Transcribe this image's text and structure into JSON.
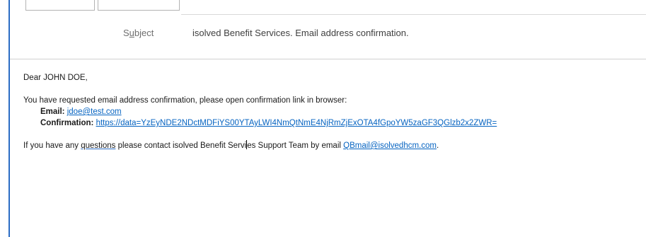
{
  "header": {
    "subject_label_pre": "S",
    "subject_label_ul": "u",
    "subject_label_post": "bject",
    "subject_value": "isolved Benefit Services. Email address confirmation."
  },
  "message": {
    "greeting": "Dear JOHN DOE,",
    "intro": "You have requested email address confirmation, please open confirmation link in browser:",
    "email_label": "Email:",
    "email_value": "jdoe@test.com",
    "confirmation_label": "Confirmation:",
    "confirmation_link": "https://data=YzEyNDE2NDctMDFiYS00YTAyLWI4NmQtNmE4NjRmZjExOTA4fGpoYW5zaGF3QGlzb2x2ZWR=",
    "closing_pre": "If you have any ",
    "closing_questions": "questions",
    "closing_mid_a": " please contact isolved Benefit Servi",
    "closing_mid_b": "es Support Team by email ",
    "support_email": "QBmail@isolvedhcm.com",
    "closing_end": "."
  }
}
